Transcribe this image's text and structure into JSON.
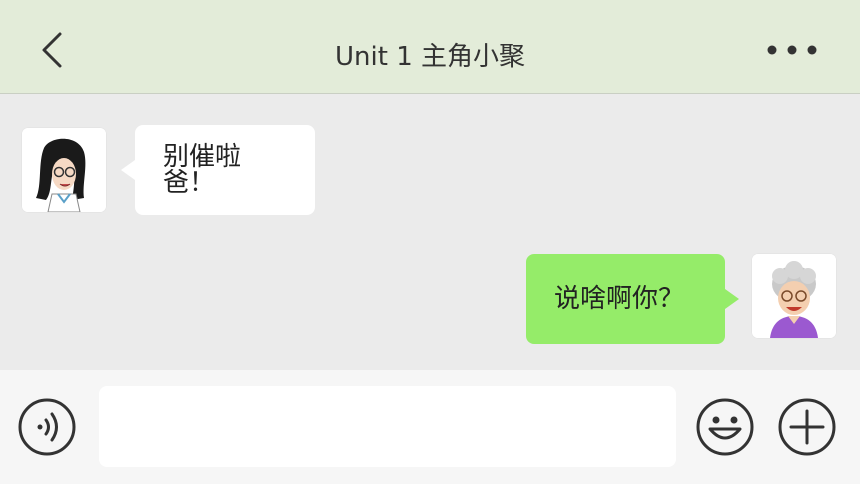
{
  "header": {
    "title": "Unit 1 主角小聚"
  },
  "messages": [
    {
      "side": "left",
      "text": "别催啦爸！",
      "avatar": "girl-with-glasses-avatar"
    },
    {
      "side": "right",
      "text": "说啥啊你？",
      "avatar": "grandma-avatar"
    }
  ],
  "input": {
    "value": ""
  },
  "icons": {
    "back": "chevron-left-icon",
    "more": "more-dots-icon",
    "voice": "voice-icon",
    "emoji": "emoji-icon",
    "add": "plus-circle-icon"
  },
  "colors": {
    "header_bg": "#e3ecd9",
    "chat_bg": "#ebebeb",
    "bubble_received": "#ffffff",
    "bubble_sent": "#95ec69",
    "input_bar_bg": "#f6f6f6"
  }
}
